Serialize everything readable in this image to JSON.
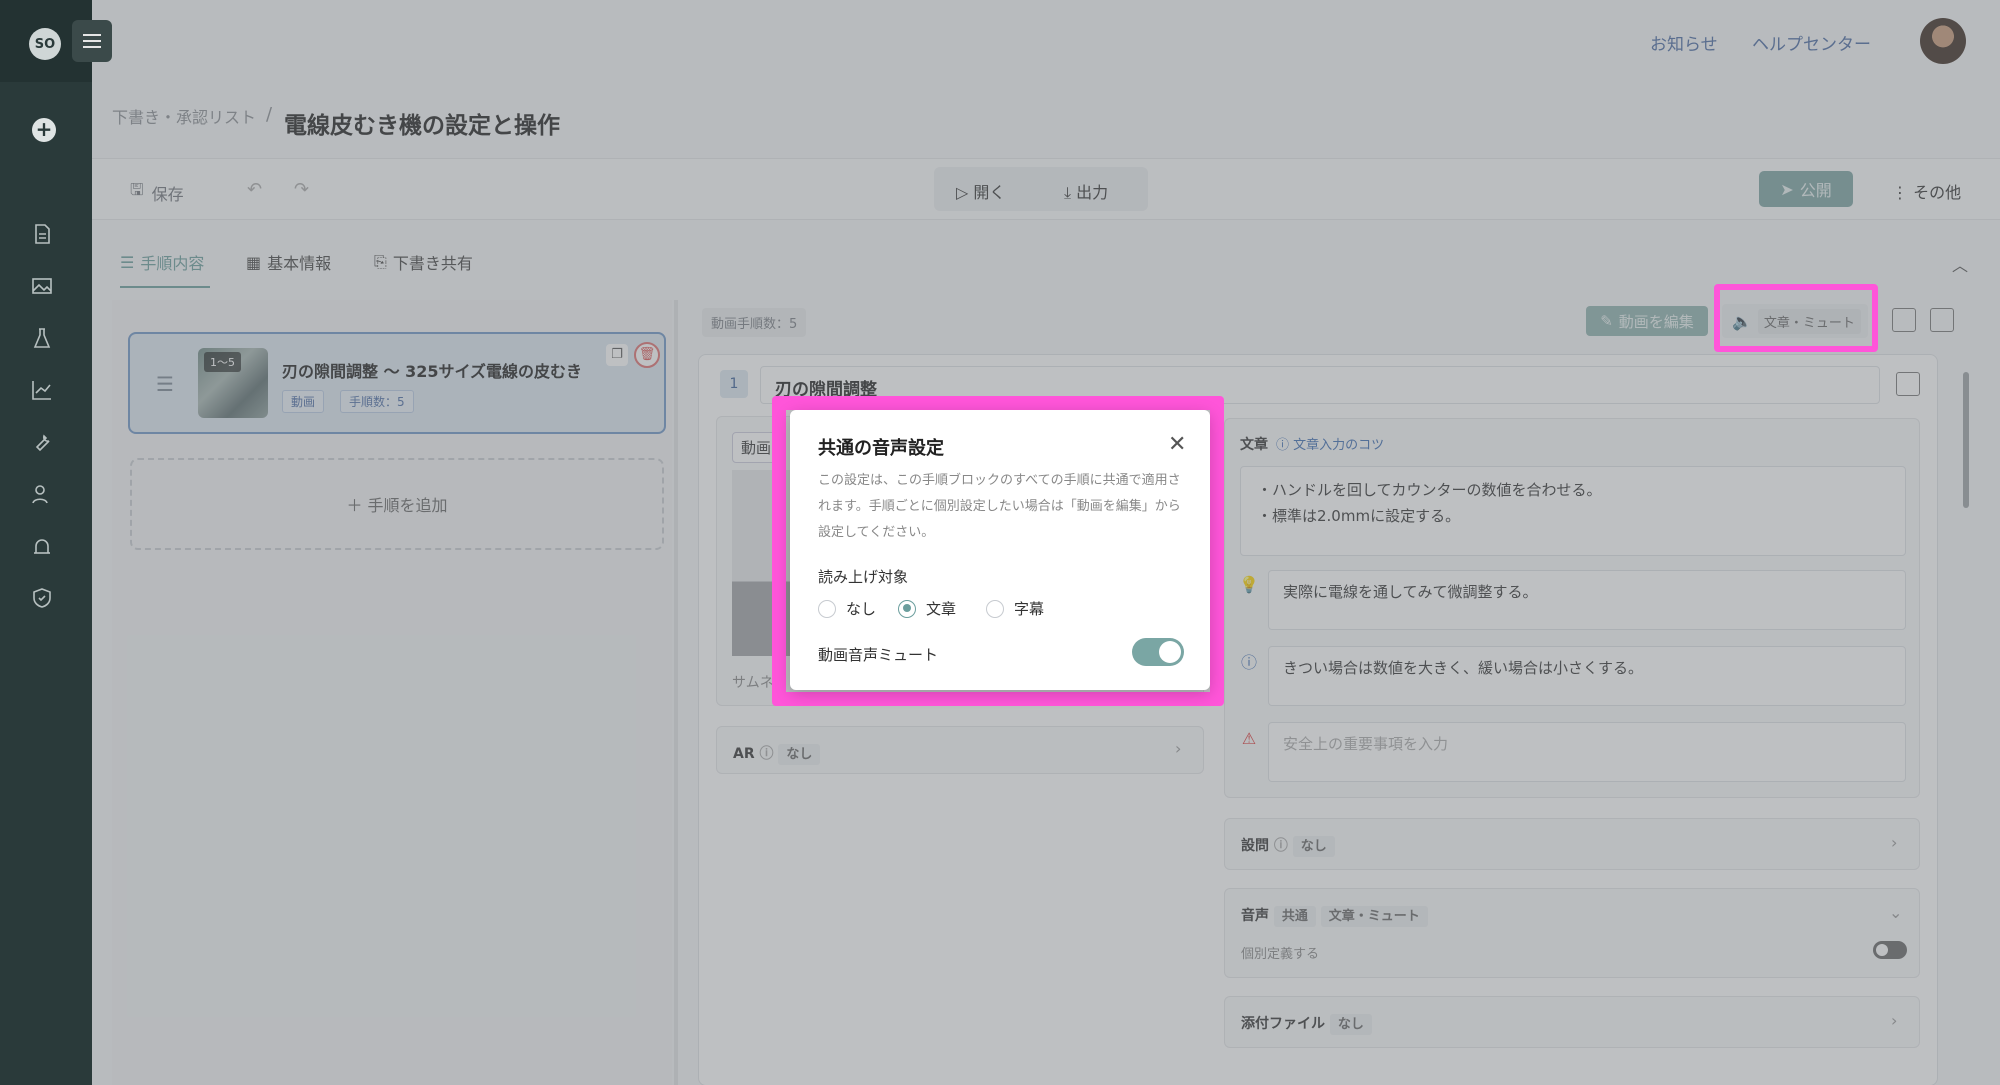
{
  "header": {
    "notice": "お知らせ",
    "help": "ヘルプセンター"
  },
  "breadcrumb": {
    "parent": "下書き・承認リスト",
    "sep": "/",
    "title": "電線皮むき機の設定と操作"
  },
  "toolbar": {
    "save": "保存",
    "open": "開く",
    "export": "出力",
    "publish": "公開",
    "more": "その他"
  },
  "tabs": [
    {
      "label": "手順内容"
    },
    {
      "label": "基本情報"
    },
    {
      "label": "下書き共有"
    }
  ],
  "step_list": {
    "card": {
      "badge": "1～5",
      "title": "刃の隙間調整 〜 325サイズ電線の皮むき",
      "type": "動画",
      "count": "手順数：5"
    },
    "add_step": "＋ 手順を追加"
  },
  "editor": {
    "video_step_count": "動画手順数：5",
    "edit_video": "動画を編集",
    "audio_tag": "文章・ミュート",
    "step_number": "1",
    "step_name": "刃の隙間調整",
    "media_tab": "動画",
    "thumb_label": "サムネ",
    "ar_label": "AR",
    "ar_value": "なし",
    "text_label": "文章",
    "text_tips": "文章入力のコツ",
    "text_line1": "・ハンドルを回してカウンターの数値を合わせる。",
    "text_line2": "・標準は2.0mmに設定する。",
    "hint": "実際に電線を通してみて微調整する。",
    "info": "きつい場合は数値を大きく、緩い場合は小さくする。",
    "warning_placeholder": "安全上の重要事項を入力",
    "question_label": "設問",
    "question_value": "なし",
    "audio_label": "音声",
    "audio_common": "共通",
    "audio_value": "文章・ミュート",
    "individual": "個別定義する",
    "attach_label": "添付ファイル",
    "attach_value": "なし"
  },
  "dialog": {
    "title": "共通の音声設定",
    "description": "この設定は、この手順ブロックのすべての手順に共通で適用されます。手順ごとに個別設定したい場合は「動画を編集」から設定してください。",
    "read_target": "読み上げ対象",
    "options": [
      {
        "label": "なし",
        "selected": false
      },
      {
        "label": "文章",
        "selected": true
      },
      {
        "label": "字幕",
        "selected": false
      }
    ],
    "mute_label": "動画音声ミュート",
    "mute_on": true
  },
  "colors": {
    "accent": "#6b9e9d",
    "highlight": "#ff55d9",
    "sidebar": "#2a3a3a"
  }
}
